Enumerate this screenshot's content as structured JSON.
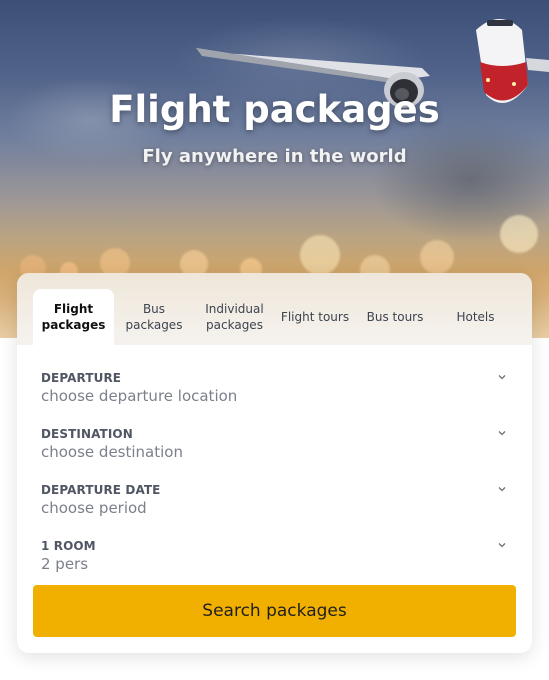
{
  "hero": {
    "title": "Flight packages",
    "subtitle": "Fly anywhere in the world"
  },
  "tabs": [
    {
      "line1": "Flight",
      "line2": "packages",
      "active": true
    },
    {
      "line1": "Bus",
      "line2": "packages",
      "active": false
    },
    {
      "line1": "Individual",
      "line2": "packages",
      "active": false
    },
    {
      "line1": "Flight tours",
      "line2": "",
      "active": false
    },
    {
      "line1": "Bus tours",
      "line2": "",
      "active": false
    },
    {
      "line1": "Hotels",
      "line2": "",
      "active": false
    }
  ],
  "form": {
    "departure": {
      "label": "DEPARTURE",
      "value": "choose departure location"
    },
    "destination": {
      "label": "DESTINATION",
      "value": "choose destination"
    },
    "date": {
      "label": "DEPARTURE DATE",
      "value": "choose period"
    },
    "room": {
      "label": "1 ROOM",
      "value": "2 pers"
    }
  },
  "search_button": "Search packages",
  "colors": {
    "accent": "#f1b000"
  }
}
